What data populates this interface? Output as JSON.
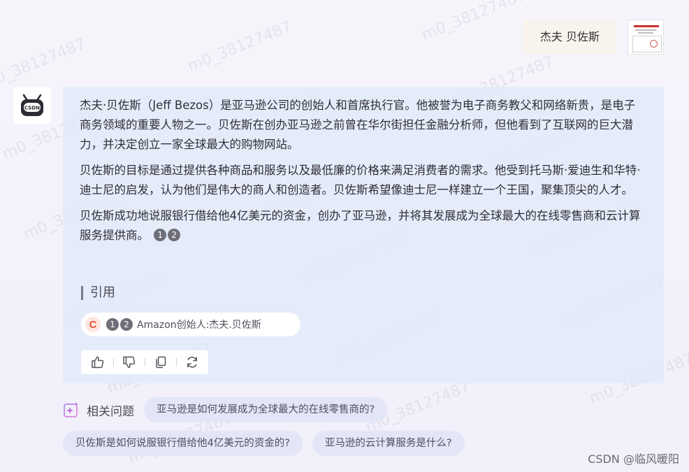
{
  "watermark_text": "m0_38127487",
  "user_message": {
    "text": "杰夫 贝佐斯",
    "avatar_icon": "document-thumbnail-icon"
  },
  "bot": {
    "avatar_icon": "robot-icon",
    "avatar_badge": "CSDN"
  },
  "answer": {
    "paragraphs": [
      "杰夫·贝佐斯（Jeff Bezos）是亚马逊公司的创始人和首席执行官。他被誉为电子商务教父和网络新贵，是电子商务领域的重要人物之一。贝佐斯在创办亚马逊之前曾在华尔街担任金融分析师，但他看到了互联网的巨大潜力，并决定创立一家全球最大的购物网站。",
      "贝佐斯的目标是通过提供各种商品和服务以及最低廉的价格来满足消费者的需求。他受到托马斯·爱迪生和华特·迪士尼的启发，认为他们是伟大的商人和创造者。贝佐斯希望像迪士尼一样建立一个王国，聚集顶尖的人才。",
      "贝佐斯成功地说服银行借给他4亿美元的资金，创办了亚马逊，并将其发展成为全球最大的在线零售商和云计算服务提供商。"
    ],
    "citations": [
      "1",
      "2"
    ]
  },
  "references": {
    "heading": "引用",
    "source_logo": "C",
    "source_logo_color": "#e5533b",
    "citations": [
      "1",
      "2"
    ],
    "title": "Amazon创始人:杰夫.贝佐斯"
  },
  "actions": [
    {
      "name": "thumbs-up-icon"
    },
    {
      "name": "thumbs-down-icon"
    },
    {
      "name": "copy-icon"
    },
    {
      "name": "regenerate-icon"
    }
  ],
  "related": {
    "label": "相关问题",
    "icon": "sparkle-icon",
    "questions": [
      "亚马逊是如何发展成为全球最大的在线零售商的?",
      "贝佐斯是如何说服银行借给他4亿美元的资金的?",
      "亚马逊的云计算服务是什么?"
    ]
  },
  "footer": {
    "mark": "CSDN @临风暖阳"
  }
}
